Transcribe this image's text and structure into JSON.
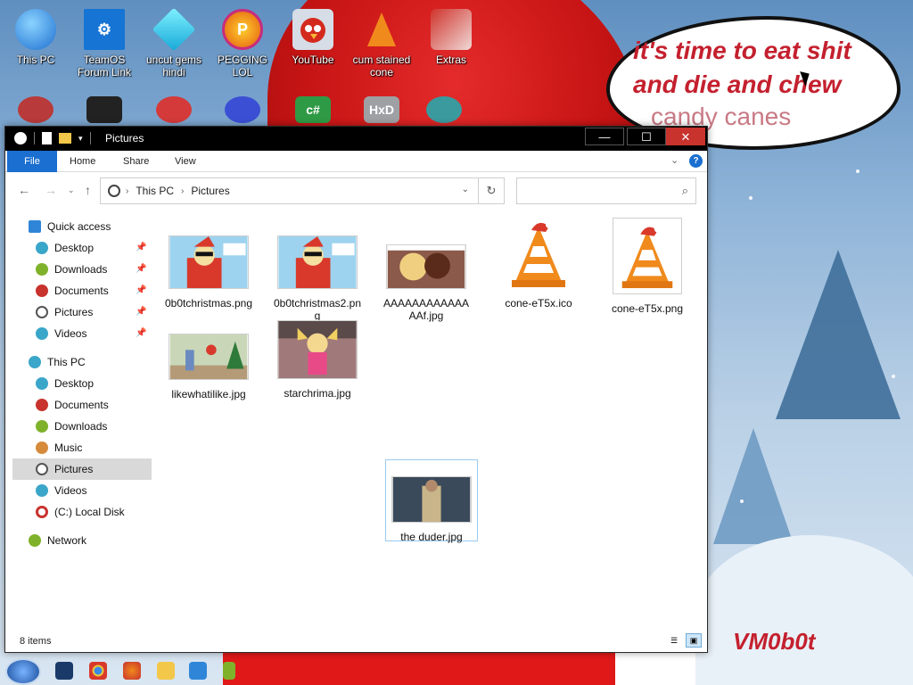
{
  "desktop": {
    "icons_row1": [
      {
        "label": "This PC",
        "icon": "this-pc-icon"
      },
      {
        "label": "TeamOS Forum Link",
        "icon": "gear-icon"
      },
      {
        "label": "uncut gems hindi",
        "icon": "gem-icon"
      },
      {
        "label": "PEGGING LOL",
        "icon": "p-game-icon"
      },
      {
        "label": "YouTube",
        "icon": "angry-bird-icon"
      },
      {
        "label": "cum stained cone",
        "icon": "traffic-cone-icon"
      },
      {
        "label": "Extras",
        "icon": "extras-icon"
      }
    ],
    "icons_row2_names": [
      "ornament-icon",
      "tablet-icon",
      "map-pin-icon",
      "ball-icon",
      "csharp-icon",
      "hex-editor-icon",
      "snake-icon"
    ],
    "speech_bubble": {
      "line1": "it's time to eat shit",
      "line2": "and die and chew",
      "line3": "candy canes"
    },
    "signature": "VM0b0t"
  },
  "window": {
    "title": "Pictures",
    "controls": {
      "minimize": "—",
      "maximize": "☐",
      "close": "✕"
    },
    "ribbon_tabs": [
      "File",
      "Home",
      "Share",
      "View"
    ],
    "address": {
      "crumbs": [
        "This PC",
        "Pictures"
      ]
    },
    "search": {
      "placeholder": "",
      "value": ""
    },
    "sidebar": {
      "quick_access": "Quick access",
      "quick_items": [
        "Desktop",
        "Downloads",
        "Documents",
        "Pictures",
        "Videos"
      ],
      "this_pc": "This PC",
      "pc_items": [
        "Desktop",
        "Documents",
        "Downloads",
        "Music",
        "Pictures",
        "Videos",
        "(C:) Local Disk"
      ],
      "network": "Network",
      "selected": "Pictures"
    },
    "files": [
      {
        "name": "0b0tchristmas.png",
        "thumb": "santa-meme"
      },
      {
        "name": "0b0tchristmas2.png",
        "thumb": "santa-meme"
      },
      {
        "name": "AAAAAAAAAAAAAAf.jpg",
        "thumb": "cartoon-kiss"
      },
      {
        "name": "cone-eT5x.ico",
        "thumb": "vlc-cone"
      },
      {
        "name": "cone-eT5x.png",
        "thumb": "vlc-cone"
      },
      {
        "name": "likewhatilike.jpg",
        "thumb": "cartoon-scene"
      },
      {
        "name": "starchrima.jpg",
        "thumb": "cartoon-star"
      },
      {
        "name": "the duder.jpg",
        "thumb": "man-robe"
      }
    ],
    "selected_file": "the duder.jpg",
    "status": "8 items"
  },
  "colors": {
    "accent": "#1a6fd0",
    "selection": "#d9d9d9",
    "titlebar": "#000000",
    "close": "#c8332d"
  }
}
